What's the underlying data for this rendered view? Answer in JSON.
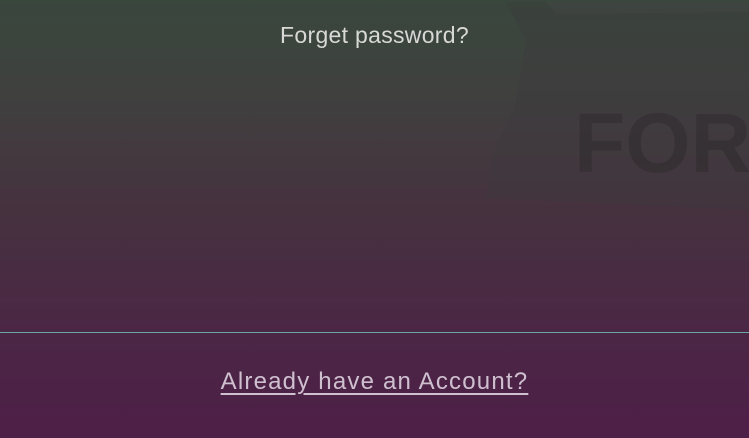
{
  "background": {
    "gradient_top": "#39473d",
    "gradient_bottom": "#4e1f48",
    "watermark_text": "FORTU"
  },
  "forgot": {
    "label": "Forget password?"
  },
  "divider": {
    "color": "#6aa7a6"
  },
  "account": {
    "label": "Already have an Account?"
  }
}
